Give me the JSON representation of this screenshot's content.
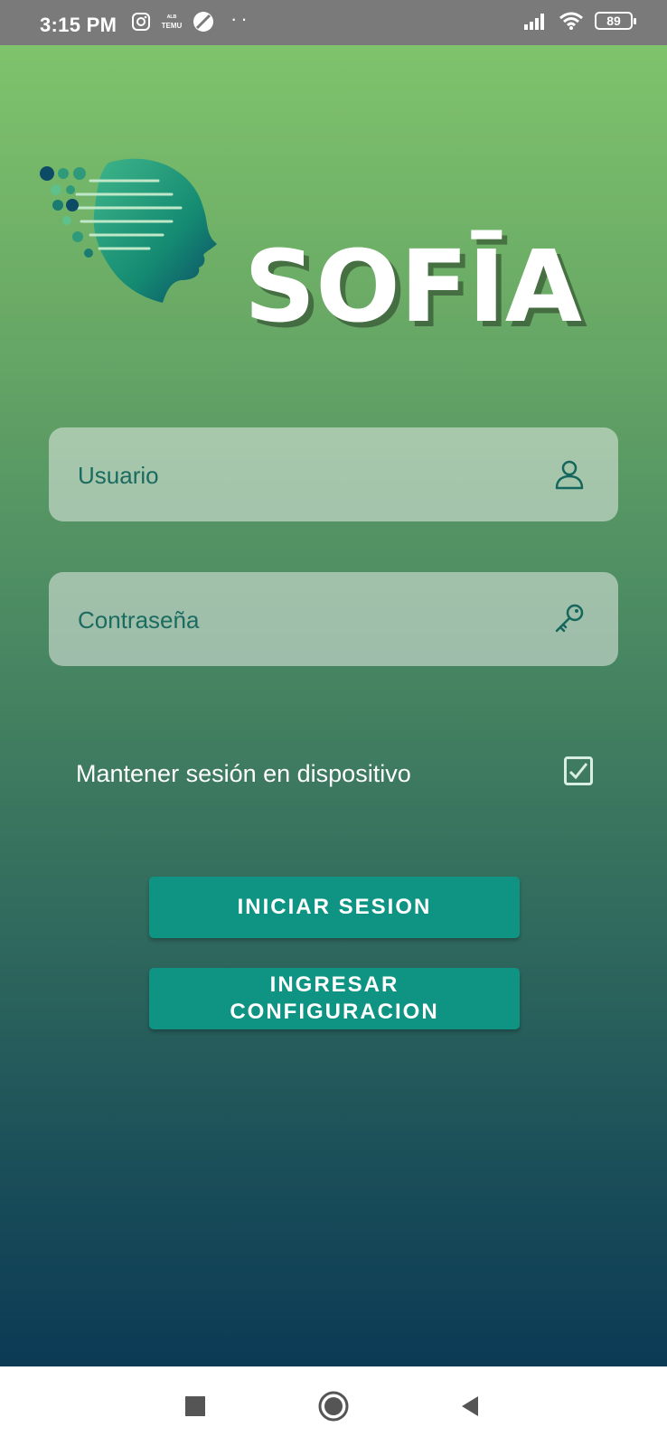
{
  "status_bar": {
    "time": "3:15 PM",
    "temu_line1": "ᴬᴸᴮ",
    "temu_line2": "TEMU",
    "battery": "89",
    "icons": [
      "instagram-icon",
      "temu-icon",
      "slash-circle-icon",
      "more-dots-icon",
      "signal-icon",
      "wifi-icon",
      "battery-icon"
    ]
  },
  "logo": {
    "text": "SOFĪA"
  },
  "login_form": {
    "username_placeholder": "Usuario",
    "password_placeholder": "Contraseña",
    "username_icon": "user-icon",
    "password_icon": "key-icon",
    "keep_session_label": "Mantener sesión en dispositivo",
    "keep_session_checked": true
  },
  "buttons": {
    "login": "INICIAR SESION",
    "config_line1": "INGRESAR",
    "config_line2": "CONFIGURACION"
  },
  "nav_bar": {
    "icons": [
      "recents-square-icon",
      "home-circle-icon",
      "back-triangle-icon"
    ]
  },
  "colors": {
    "accent": "#0f9484",
    "gradient_top": "#7fc36c",
    "gradient_bottom": "#0b3a55",
    "field_text": "#15665c"
  }
}
